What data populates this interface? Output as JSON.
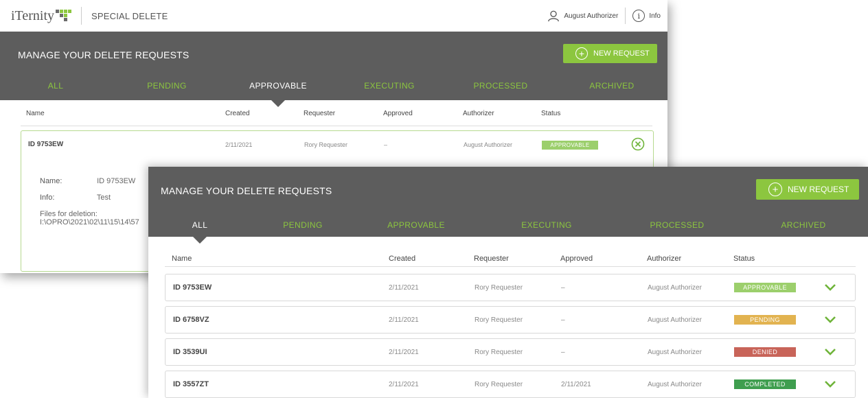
{
  "app": {
    "logo_text": "iTernity",
    "title": "SPECIAL DELETE"
  },
  "topbar": {
    "user_name": "August Authorizer",
    "info_label": "Info"
  },
  "header": {
    "title": "MANAGE YOUR DELETE REQUESTS",
    "new_request_label": "NEW REQUEST"
  },
  "tabs": [
    "ALL",
    "PENDING",
    "APPROVABLE",
    "EXECUTING",
    "PROCESSED",
    "ARCHIVED"
  ],
  "columns": {
    "name": "Name",
    "created": "Created",
    "requester": "Requester",
    "approved": "Approved",
    "authorizer": "Authorizer",
    "status": "Status"
  },
  "back_window": {
    "active_tab": "APPROVABLE",
    "row": {
      "name": "ID 9753EW",
      "created": "2/11/2021",
      "requester": "Rory Requester",
      "approved": "–",
      "authorizer": "August Authorizer",
      "status": "APPROVABLE"
    },
    "detail": {
      "name_label": "Name:",
      "name_value": "ID 9753EW",
      "info_label": "Info:",
      "info_value": "Test",
      "files_label": "Files for deletion:",
      "files_value": "I:\\OPRO\\2021\\02\\11\\15\\14\\57"
    }
  },
  "front_window": {
    "active_tab": "ALL",
    "rows": [
      {
        "name": "ID 9753EW",
        "created": "2/11/2021",
        "requester": "Rory Requester",
        "approved": "–",
        "authorizer": "August Authorizer",
        "status": "APPROVABLE"
      },
      {
        "name": "ID 6758VZ",
        "created": "2/11/2021",
        "requester": "Rory Requester",
        "approved": "–",
        "authorizer": "August Authorizer",
        "status": "PENDING"
      },
      {
        "name": "ID 3539UI",
        "created": "2/11/2021",
        "requester": "Rory Requester",
        "approved": "–",
        "authorizer": "August Authorizer",
        "status": "DENIED"
      },
      {
        "name": "ID 3557ZT",
        "created": "2/11/2021",
        "requester": "Rory Requester",
        "approved": "2/11/2021",
        "authorizer": "August Authorizer",
        "status": "COMPLETED"
      }
    ]
  },
  "colors": {
    "accent": "#8cc63f",
    "header_bg": "#5d5d5d",
    "approvable": "#9ccf6c",
    "pending": "#e2b350",
    "denied": "#c86459",
    "completed": "#3f9e4f"
  }
}
